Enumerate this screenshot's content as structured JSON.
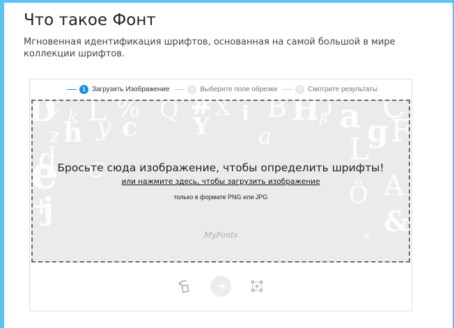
{
  "page": {
    "title": "Что такое Фонт",
    "subtitle": "Мгновенная идентификация шрифтов, основанная на самой большой в мире коллекции шрифтов."
  },
  "steps": [
    {
      "number": "1",
      "label": "Загрузить Изображение",
      "active": true
    },
    {
      "number": "2",
      "label": "Выберите поле обрезки",
      "active": false
    },
    {
      "number": "3",
      "label": "Смотрите результаты",
      "active": false
    }
  ],
  "dropzone": {
    "title": "Бросьте сюда изображение, чтобы определить шрифты!",
    "link": "или нажмите здесь, чтобы загрузить изображение",
    "note": "только в формате PNG или JPG",
    "logo": "MyFonts",
    "background_glyphs": [
      "D",
      "C",
      "k",
      "L",
      "%",
      "Q",
      "#",
      "X",
      "i",
      "B",
      "H",
      "J",
      "β",
      "a",
      "C",
      "z",
      "h",
      "y",
      "c",
      "Y",
      "a",
      "g",
      "F",
      "e",
      "d",
      "G",
      "L",
      "A",
      "+",
      "j",
      "Ö",
      "&",
      "*"
    ]
  },
  "tools": {
    "rotate_icon": "rotate-icon",
    "next_icon": "arrow-right-icon",
    "crop_icon": "crop-frame-icon"
  },
  "colors": {
    "accent": "#1b8fd8",
    "frame": "#5bc3ef",
    "dropzone_bg": "#ebebeb"
  }
}
